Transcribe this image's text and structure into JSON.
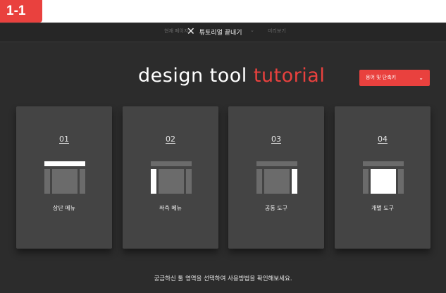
{
  "step_badge": "1-1",
  "topbar": {
    "left_text": "현재 페이지",
    "close_label": "튜토리얼 끝내기",
    "right_text": "미리보기"
  },
  "logo": {
    "word1": "design tool ",
    "word2": "tutorial"
  },
  "shortcut_button": {
    "label": "용어 및 단축키"
  },
  "cards": [
    {
      "number": "01",
      "label": "상단 메뉴"
    },
    {
      "number": "02",
      "label": "좌측 메뉴"
    },
    {
      "number": "03",
      "label": "공통 도구"
    },
    {
      "number": "04",
      "label": "개별 도구"
    }
  ],
  "hint": "궁금하신 툴 영역을 선택하여 사용방법을 확인해보세요.",
  "colors": {
    "accent": "#e9413e",
    "background": "#2c2c2c",
    "card": "#444444"
  },
  "icons": [
    "close-icon",
    "chevron-down-icon"
  ]
}
